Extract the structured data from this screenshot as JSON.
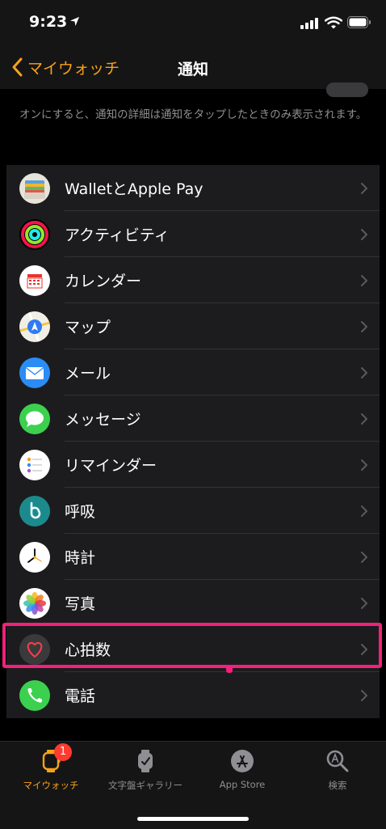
{
  "status_bar": {
    "time": "9:23"
  },
  "nav": {
    "back_label": "マイウォッチ",
    "title": "通知"
  },
  "footer_note": "オンにすると、通知の詳細は通知をタップしたときのみ表示されます。",
  "apps": [
    {
      "label": "WalletとApple Pay",
      "icon": "wallet-icon"
    },
    {
      "label": "アクティビティ",
      "icon": "activity-icon"
    },
    {
      "label": "カレンダー",
      "icon": "calendar-icon"
    },
    {
      "label": "マップ",
      "icon": "maps-icon"
    },
    {
      "label": "メール",
      "icon": "mail-icon"
    },
    {
      "label": "メッセージ",
      "icon": "messages-icon"
    },
    {
      "label": "リマインダー",
      "icon": "reminders-icon"
    },
    {
      "label": "呼吸",
      "icon": "breathe-icon"
    },
    {
      "label": "時計",
      "icon": "clock-icon"
    },
    {
      "label": "写真",
      "icon": "photos-icon"
    },
    {
      "label": "心拍数",
      "icon": "heart-rate-icon"
    },
    {
      "label": "電話",
      "icon": "phone-icon"
    }
  ],
  "tabs": [
    {
      "label": "マイウォッチ",
      "icon": "my-watch-icon",
      "badge": "1",
      "active": true
    },
    {
      "label": "文字盤ギャラリー",
      "icon": "face-gallery-icon"
    },
    {
      "label": "App Store",
      "icon": "app-store-icon"
    },
    {
      "label": "検索",
      "icon": "search-icon"
    }
  ],
  "colors": {
    "accent": "#f7a21b",
    "highlight": "#f4207c",
    "badge": "#ff3b30",
    "row_bg": "#1c1c1e"
  }
}
